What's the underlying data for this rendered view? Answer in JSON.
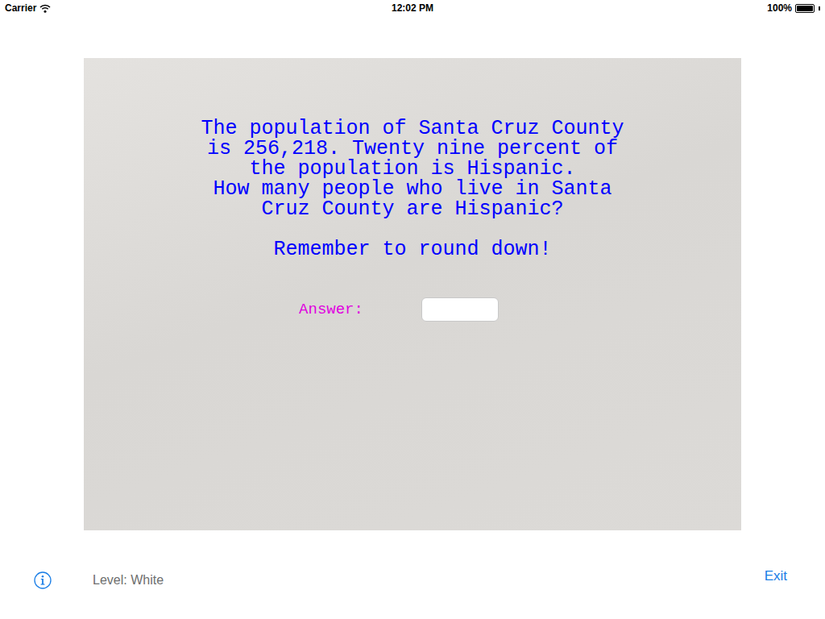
{
  "status_bar": {
    "carrier": "Carrier",
    "time": "12:02 PM",
    "battery": "100%",
    "battery_level": 1.0
  },
  "question": {
    "lines": [
      "The population of Santa Cruz County",
      "is 256,218. Twenty nine percent of",
      "the population is Hispanic.",
      "How many people who live in Santa",
      "Cruz County are Hispanic?"
    ],
    "reminder": "Remember to round down!"
  },
  "answer": {
    "label": "Answer:",
    "value": ""
  },
  "footer": {
    "level": "Level: White",
    "exit": "Exit"
  }
}
